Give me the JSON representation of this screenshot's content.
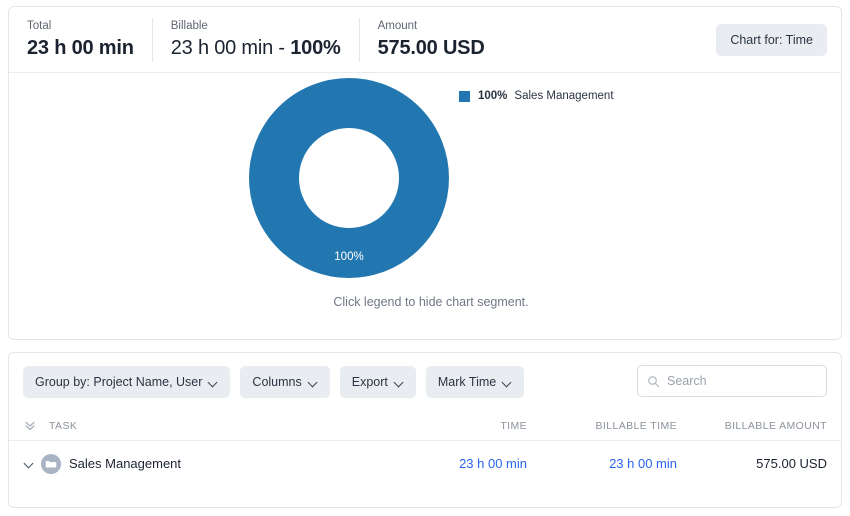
{
  "summary": {
    "stats": [
      {
        "label": "Total",
        "value": "23 h 00 min"
      },
      {
        "label": "Billable",
        "value_light": "23 h 00 min - ",
        "value_strong": "100%"
      },
      {
        "label": "Amount",
        "value": "575.00 USD"
      }
    ],
    "chart_for_button": "Chart for: Time"
  },
  "chart_data": {
    "type": "pie",
    "variant": "donut",
    "title": "",
    "labels": [
      "Sales Management"
    ],
    "values": [
      100
    ],
    "value_unit": "%",
    "colors": [
      "#2277b0"
    ],
    "segment_labels": [
      "100%"
    ],
    "legend": {
      "position": "right",
      "entries": [
        {
          "percent": "100%",
          "name": "Sales Management",
          "color": "#2277b0"
        }
      ]
    },
    "hint": "Click legend to hide chart segment."
  },
  "toolbar": {
    "buttons": [
      {
        "label": "Group by: Project Name, User",
        "icon": "chevron-down-icon"
      },
      {
        "label": "Columns",
        "icon": "chevron-down-icon"
      },
      {
        "label": "Export",
        "icon": "chevron-down-icon"
      },
      {
        "label": "Mark Time",
        "icon": "chevron-down-icon"
      }
    ],
    "search": {
      "placeholder": "Search",
      "value": "",
      "icon": "search-icon"
    }
  },
  "table": {
    "collapse_icon": "double-chevron-down-icon",
    "columns": [
      "TASK",
      "TIME",
      "BILLABLE TIME",
      "BILLABLE AMOUNT"
    ],
    "rows": [
      {
        "task": "Sales Management",
        "time": "23 h 00 min",
        "billable_time": "23 h 00 min",
        "billable_amount": "575.00 USD",
        "icon": "folder-avatar-icon",
        "expander": "chevron-down-icon"
      }
    ]
  },
  "colors": {
    "chart_blue": "#2277b0",
    "link_blue": "#2a66f0",
    "button_grey": "#e9edf1",
    "text_dark": "#1b2330",
    "text_muted": "#707886"
  }
}
